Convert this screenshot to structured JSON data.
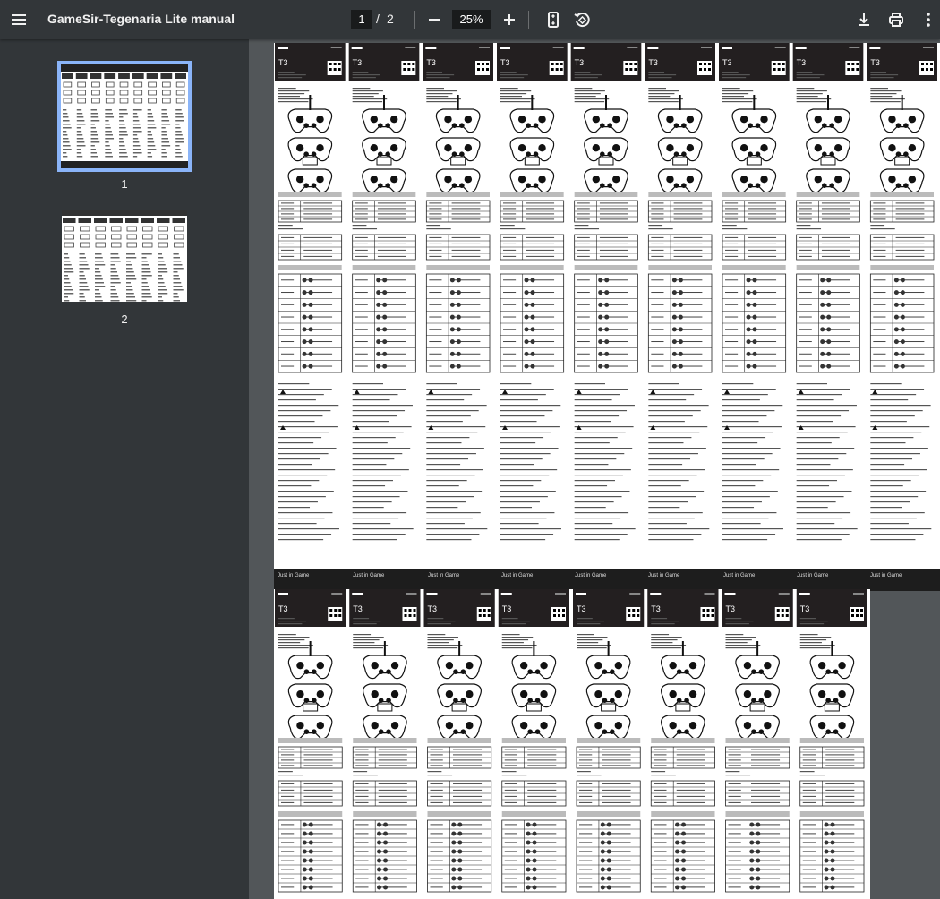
{
  "toolbar": {
    "title": "GameSir-Tegenaria Lite manual",
    "current_page": "1",
    "page_separator": "/",
    "total_pages": "2",
    "zoom": "25%"
  },
  "thumbnails": [
    {
      "label": "1",
      "selected": true
    },
    {
      "label": "2",
      "selected": false
    }
  ],
  "banner": {
    "slogan": "Just in Game"
  },
  "icons": {
    "menu": "menu-icon",
    "zoom_out": "minus-icon",
    "zoom_in": "plus-icon",
    "fit": "fit-page-icon",
    "rotate": "rotate-icon",
    "download": "download-icon",
    "print": "print-icon",
    "more": "more-vert-icon"
  },
  "colors": {
    "toolbar_bg": "#323639",
    "viewer_bg": "#525659",
    "selected_thumb_border": "#8ab4f8"
  }
}
